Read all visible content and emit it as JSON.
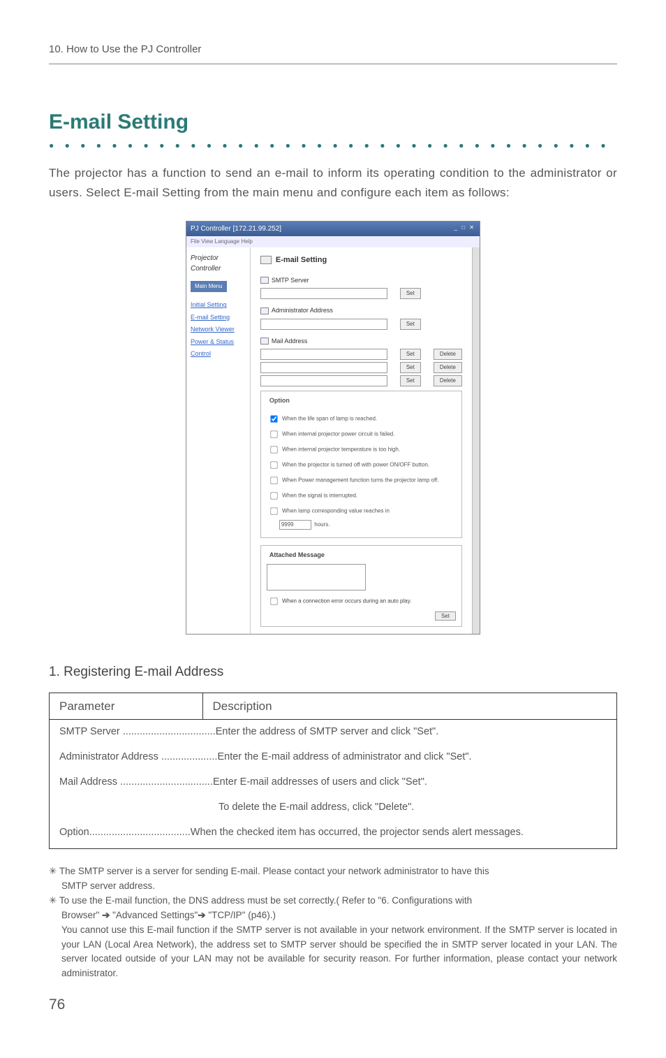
{
  "chapter": "10. How to Use the PJ Controller",
  "section_title": "E-mail Setting",
  "intro": "The projector has a function to send an e-mail to inform its operating condition to the administrator or users.  Select E-mail Setting from the main menu and configure each item as follows:",
  "screenshot": {
    "titlebar": "PJ Controller [172.21.99.252]",
    "menubar": "File  View  Language  Help",
    "side_title": "Projector Controller",
    "main_menu": "Main Menu",
    "nav": [
      "Initial Setting",
      "E-mail Setting",
      "Network Viewer",
      "Power & Status",
      "Control"
    ],
    "main_title": "E-mail Setting",
    "smtp_label": "SMTP Server",
    "admin_label": "Administrator Address",
    "mail_label": "Mail Address",
    "set_btn": "Set",
    "delete_btn": "Delete",
    "option_title": "Option",
    "opts": [
      "When the life span of lamp is reached.",
      "When internal projector power circuit is failed.",
      "When internal projector temperature is too high.",
      "When the projector is turned off with power ON/OFF button.",
      "When Power management function turns the projector lamp off.",
      "When the signal is interrupted.",
      "When lamp corresponding value reaches in"
    ],
    "hours_value": "9999",
    "hours_suffix": "hours.",
    "attached_title": "Attached Message",
    "autoplay_opt": "When a connection error occurs during an auto play."
  },
  "subhead": "1. Registering E-mail Address",
  "table": {
    "h1": "Parameter",
    "h2": "Description",
    "rows": [
      {
        "label": "SMTP Server ",
        "dots": ".................................",
        "desc": "Enter the address of SMTP server and click \"Set\"."
      },
      {
        "label": "Administrator Address ",
        "dots": "....................",
        "desc": "Enter the E-mail address of administrator and click \"Set\"."
      },
      {
        "label": "Mail Address ",
        "dots": ".................................",
        "desc": "Enter E-mail addresses of users and click \"Set\"."
      },
      {
        "label": "",
        "dots": "",
        "desc": "To delete the E-mail address, click \"Delete\".",
        "indent": true
      },
      {
        "label": "Option",
        "dots": "....................................",
        "desc": "When the checked item has occurred, the projector sends alert messages.",
        "wrap": true
      }
    ]
  },
  "notes": {
    "n1a": "✳ The SMTP server is a server for sending E-mail. Please contact your network administrator to have this",
    "n1b": "SMTP server address.",
    "n2a": "✳ To use the E-mail function, the DNS address must be set correctly.( Refer to \"6. Configurations with",
    "n2b_prefix": "Browser\" ",
    "n2b_mid": " \"Advanced Settings\"",
    "n2b_suffix": " \"TCP/IP\" (p46).)",
    "n3": "You cannot use this E-mail function if the SMTP server is not available in your network environment. If the SMTP server is located in your LAN (Local Area Network), the address set to SMTP server should be specified the in SMTP server located in your LAN. The server located outside of your LAN may not be available for security reason. For further information, please contact your network administrator."
  },
  "arrow": "➔",
  "page": "76"
}
